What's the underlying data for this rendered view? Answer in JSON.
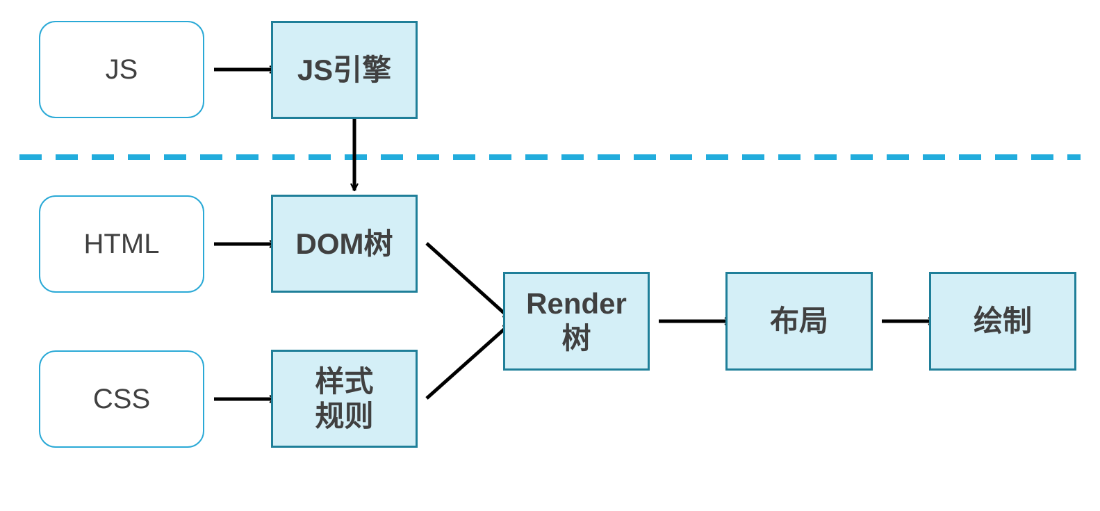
{
  "colors": {
    "input_border": "#2aa9d6",
    "process_border": "#1f7f99",
    "process_fill": "#d4eff7",
    "divider": "#22acdc",
    "arrow": "#000000",
    "text": "#404040"
  },
  "inputs": {
    "js": "JS",
    "html": "HTML",
    "css": "CSS"
  },
  "processes": {
    "js_engine": "JS引擎",
    "dom_tree": "DOM树",
    "style_rules_line1": "样式",
    "style_rules_line2": "规则",
    "render_tree_line1": "Render",
    "render_tree_line2": "树",
    "layout": "布局",
    "paint": "绘制"
  }
}
